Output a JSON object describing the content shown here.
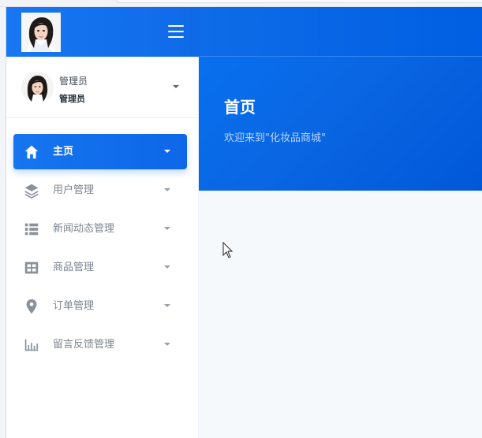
{
  "header": {
    "menu_toggle_icon": "hamburger-menu-icon"
  },
  "user": {
    "name": "管理员",
    "role": "管理员"
  },
  "sidebar": {
    "items": [
      {
        "label": "主页",
        "icon": "home-icon",
        "active": true
      },
      {
        "label": "用户管理",
        "icon": "layers-icon",
        "active": false
      },
      {
        "label": "新闻动态管理",
        "icon": "list-icon",
        "active": false
      },
      {
        "label": "商品管理",
        "icon": "grid-icon",
        "active": false
      },
      {
        "label": "订单管理",
        "icon": "location-pin-icon",
        "active": false
      },
      {
        "label": "留言反馈管理",
        "icon": "bar-chart-icon",
        "active": false
      }
    ]
  },
  "main": {
    "title": "首页",
    "welcome": "欢迎来到\"化妆品商城\""
  },
  "colors": {
    "primary": "#0f6ce8",
    "sidebar_text": "#7d8590",
    "content_bg": "#f6f9fc"
  }
}
